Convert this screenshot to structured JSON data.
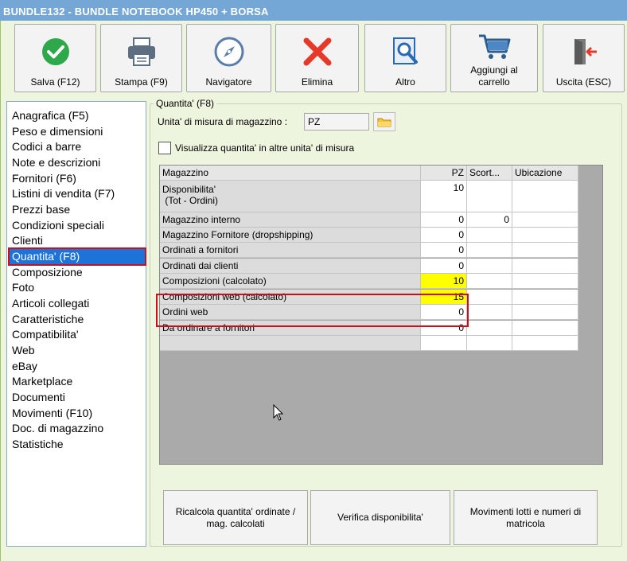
{
  "window": {
    "title": "BUNDLE132 - BUNDLE NOTEBOOK HP450 + BORSA"
  },
  "toolbar": [
    {
      "label": "Salva (F12)",
      "icon": "check-icon"
    },
    {
      "label": "Stampa (F9)",
      "icon": "printer-icon"
    },
    {
      "label": "Navigatore",
      "icon": "compass-icon"
    },
    {
      "label": "Elimina",
      "icon": "delete-x-icon"
    },
    {
      "label": "Altro",
      "icon": "search-document-icon"
    },
    {
      "label": "Aggiungi al carrello",
      "icon": "cart-icon"
    },
    {
      "label": "Uscita (ESC)",
      "icon": "exit-door-icon"
    }
  ],
  "nav": {
    "items": [
      "Anagrafica (F5)",
      "Peso e dimensioni",
      "Codici a barre",
      "Note e descrizioni",
      "Fornitori (F6)",
      "Listini di vendita (F7)",
      "Prezzi base",
      "Condizioni speciali",
      "Clienti",
      "Quantita' (F8)",
      "Composizione",
      "Foto",
      "Articoli collegati",
      "Caratteristiche",
      "Compatibilita'",
      "Web",
      "eBay",
      "Marketplace",
      "Documenti",
      "Movimenti (F10)",
      "Doc. di magazzino",
      "Statistiche"
    ],
    "selected_index": 9
  },
  "quantity": {
    "group_title": "Quantita' (F8)",
    "um_label": "Unita' di misura di magazzino :",
    "um_value": "PZ",
    "checkbox_label": "Visualizza quantita' in altre unita' di misura",
    "checkbox_checked": false
  },
  "grid": {
    "headers": [
      "Magazzino",
      "PZ",
      "Scort...",
      "Ubicazione"
    ],
    "rows": [
      {
        "label": "Disponibilita'\n (Tot - Ordini)",
        "pz": "10",
        "scort": "",
        "ubic": ""
      },
      {
        "label": "Magazzino interno",
        "pz": "0",
        "scort": "0",
        "ubic": ""
      },
      {
        "label": "Magazzino Fornitore (dropshipping)",
        "pz": "0",
        "scort": "",
        "ubic": ""
      },
      {
        "label": "Ordinati a fornitori",
        "pz": "0",
        "scort": "",
        "ubic": ""
      },
      {
        "label": "Ordinati dai clienti",
        "pz": "0",
        "scort": "",
        "ubic": ""
      },
      {
        "label": "Composizioni (calcolato)",
        "pz": "10",
        "scort": "",
        "ubic": ""
      },
      {
        "label": "Composizioni web (calcolato)",
        "pz": "15",
        "scort": "",
        "ubic": ""
      },
      {
        "label": "Ordini web",
        "pz": "0",
        "scort": "",
        "ubic": ""
      },
      {
        "label": "Da ordinare a fornitori",
        "pz": "0",
        "scort": "",
        "ubic": ""
      },
      {
        "label": "",
        "pz": "",
        "scort": "",
        "ubic": ""
      }
    ],
    "highlight_color": "#ffff00"
  },
  "bottom_buttons": [
    "Ricalcola quantita' ordinate / mag. calcolati",
    "Verifica disponibilita'",
    "Movimenti lotti e numeri di matricola"
  ],
  "colors": {
    "title_bar": "#74a7d6",
    "selection": "#1e73d8",
    "annotation_red": "#c8101c"
  }
}
